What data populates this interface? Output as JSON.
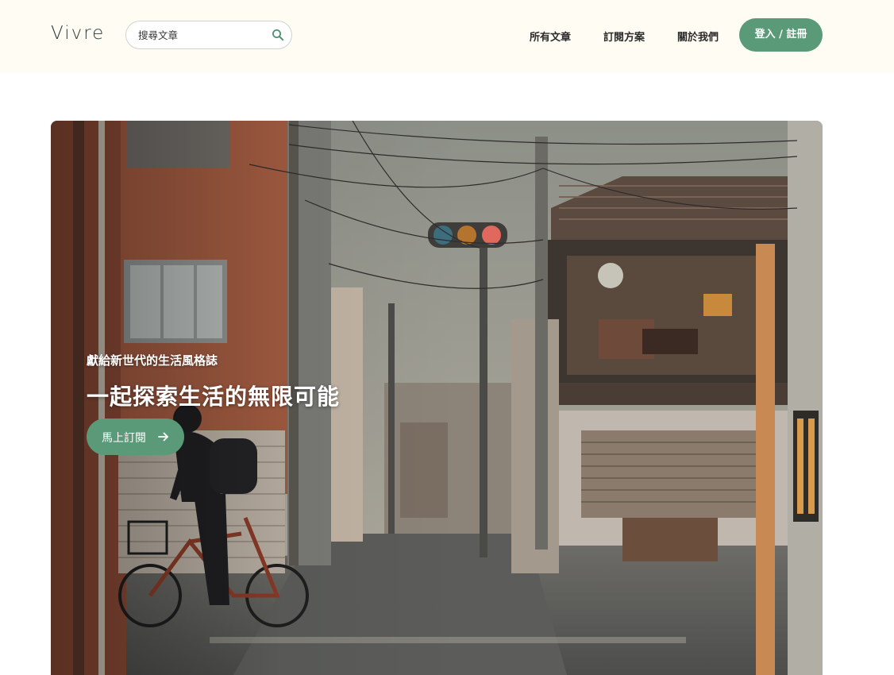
{
  "header": {
    "logo": "Vivre",
    "search": {
      "placeholder": "搜尋文章",
      "value": "",
      "icon": "search-icon"
    },
    "nav": [
      {
        "label": "所有文章"
      },
      {
        "label": "訂閱方案"
      },
      {
        "label": "關於我們"
      }
    ],
    "login_label": "登入 / 註冊"
  },
  "hero": {
    "subtitle": "獻給新世代的生活風格誌",
    "title": "一起探索生活的無限可能",
    "cta_label": "馬上訂閱",
    "cta_icon": "arrow-right-icon"
  },
  "colors": {
    "accent": "#5a9a78",
    "header_bg": "#fffcf3",
    "page_bg": "#ffffff"
  }
}
